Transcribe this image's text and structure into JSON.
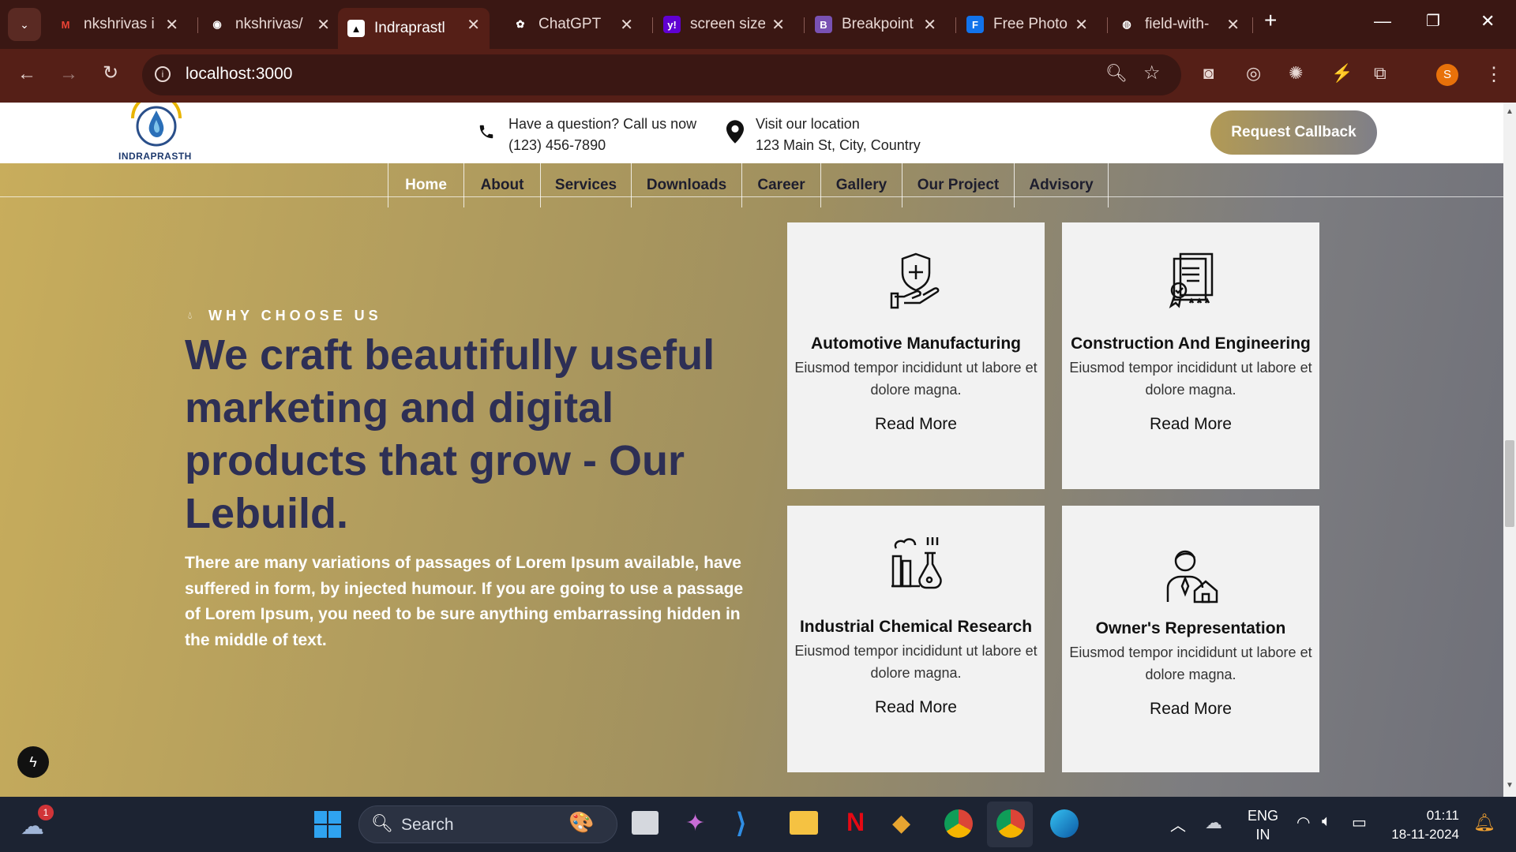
{
  "browser": {
    "tabs": [
      {
        "title": "nkshrivas i",
        "icon": "gmail-icon",
        "color": "#ea4335"
      },
      {
        "title": "nkshrivas/",
        "icon": "github-icon",
        "color": "#ffffff"
      },
      {
        "title": "Indraprastl",
        "icon": "vercel-icon",
        "color": "#000000"
      },
      {
        "title": "ChatGPT",
        "icon": "chatgpt-icon",
        "color": "#ffffff"
      },
      {
        "title": "screen size",
        "icon": "yahoo-icon",
        "color": "#6001d2"
      },
      {
        "title": "Breakpoint",
        "icon": "bootstrap-icon",
        "color": "#7952b3"
      },
      {
        "title": "Free Photo",
        "icon": "freepik-icon",
        "color": "#1273eb"
      },
      {
        "title": "field-with-",
        "icon": "globe-icon",
        "color": "#aaaaaa"
      }
    ],
    "url": "localhost:3000",
    "profile_initial": "S"
  },
  "header": {
    "logo_text": "INDRAPRASTH",
    "phone_line1": "Have a question? Call us now",
    "phone_line2": "(123) 456-7890",
    "loc_line1": "Visit our location",
    "loc_line2": "123 Main St, City, Country",
    "cta": "Request Callback"
  },
  "nav": [
    "Home",
    "About",
    "Services",
    "Downloads",
    "Career",
    "Gallery",
    "Our Project",
    "Advisory"
  ],
  "hero": {
    "eyebrow": "WHY CHOOSE US",
    "heading": "We craft beautifully useful marketing and digital products that grow - Our Lebuild.",
    "body": "There are many variations of passages of Lorem Ipsum available, have suffered in form, by injected humour. If you are going to use a passage of Lorem Ipsum, you need to be sure anything embarrassing hidden in the middle of text."
  },
  "cards": [
    {
      "title": "Automotive Manufacturing",
      "text": "Eiusmod tempor incididunt ut labore et dolore magna.",
      "link": "Read More",
      "icon": "shield-hand-icon"
    },
    {
      "title": "Construction And Engineering",
      "text": "Eiusmod tempor incididunt ut labore et dolore magna.",
      "link": "Read More",
      "icon": "certificate-icon"
    },
    {
      "title": "Industrial Chemical Research",
      "text": "Eiusmod tempor incididunt ut labore et dolore magna.",
      "link": "Read More",
      "icon": "chemical-factory-icon"
    },
    {
      "title": "Owner's Representation",
      "text": "Eiusmod tempor incididunt ut labore et dolore magna.",
      "link": "Read More",
      "icon": "agent-house-icon"
    }
  ],
  "taskbar": {
    "search": "Search",
    "lang1": "ENG",
    "lang2": "IN",
    "time": "01:11",
    "date": "18-11-2024",
    "weather_badge": "1"
  }
}
